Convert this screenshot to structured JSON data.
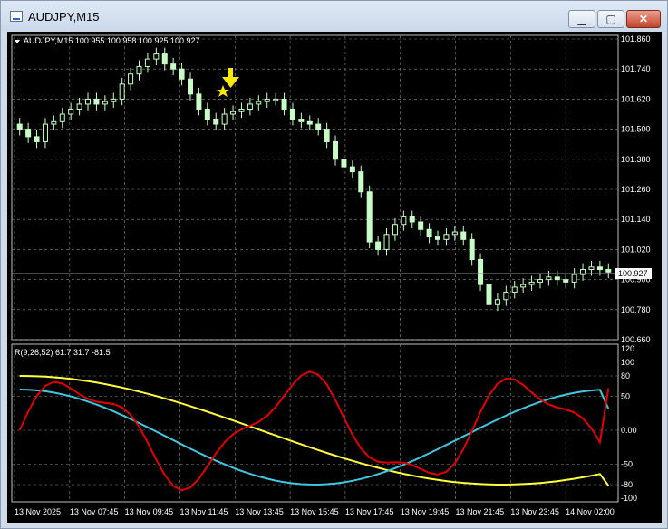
{
  "window": {
    "title": "AUDJPY,M15",
    "min_label": "▁",
    "max_label": "▢",
    "close_label": "✕"
  },
  "main_chart": {
    "header": "AUDJPY,M15  100.955 100.958 100.925 100.927",
    "price_ticks": [
      "101.860",
      "101.740",
      "101.620",
      "101.500",
      "101.380",
      "101.260",
      "101.140",
      "101.020",
      "100.900",
      "100.780",
      "100.660"
    ],
    "current_price": "100.927",
    "candle_color": "#c7ffc7",
    "grid_color": "#8c8c8c"
  },
  "indicator": {
    "header": "R(9,26,52) 61.7 31.7 -81.5",
    "ticks": [
      "120",
      "100",
      "80",
      "50",
      "0.00",
      "-50",
      "-80",
      "-100"
    ],
    "colors": {
      "fast": "#e00000",
      "mid": "#40c8e0",
      "slow": "#ffff40"
    }
  },
  "time_axis": {
    "labels": [
      "13 Nov 2025",
      "13 Nov 07:45",
      "13 Nov 09:45",
      "13 Nov 11:45",
      "13 Nov 13:45",
      "13 Nov 15:45",
      "13 Nov 17:45",
      "13 Nov 19:45",
      "13 Nov 21:45",
      "13 Nov 23:45",
      "14 Nov 02:00"
    ]
  },
  "chart_data": {
    "type": "candlestick",
    "symbol": "AUDJPY",
    "timeframe": "M15",
    "ylim": [
      100.66,
      101.86
    ],
    "ohlc_close_approx": [
      101.5,
      101.47,
      101.45,
      101.52,
      101.53,
      101.56,
      101.58,
      101.6,
      101.62,
      101.6,
      101.61,
      101.62,
      101.68,
      101.72,
      101.75,
      101.78,
      101.8,
      101.76,
      101.74,
      101.7,
      101.64,
      101.58,
      101.54,
      101.52,
      101.56,
      101.57,
      101.58,
      101.6,
      101.61,
      101.62,
      101.62,
      101.58,
      101.54,
      101.53,
      101.52,
      101.5,
      101.45,
      101.38,
      101.35,
      101.33,
      101.25,
      101.05,
      101.02,
      101.08,
      101.12,
      101.15,
      101.13,
      101.1,
      101.07,
      101.06,
      101.08,
      101.09,
      101.06,
      100.98,
      100.88,
      100.8,
      100.82,
      100.85,
      100.87,
      100.88,
      100.89,
      100.9,
      100.91,
      100.9,
      100.89,
      100.92,
      100.94,
      100.95,
      100.94,
      100.93
    ],
    "oscillator": {
      "params": "9,26,52",
      "last_values": [
        61.7,
        31.7,
        -81.5
      ],
      "ylim": [
        -100,
        120
      ]
    }
  }
}
